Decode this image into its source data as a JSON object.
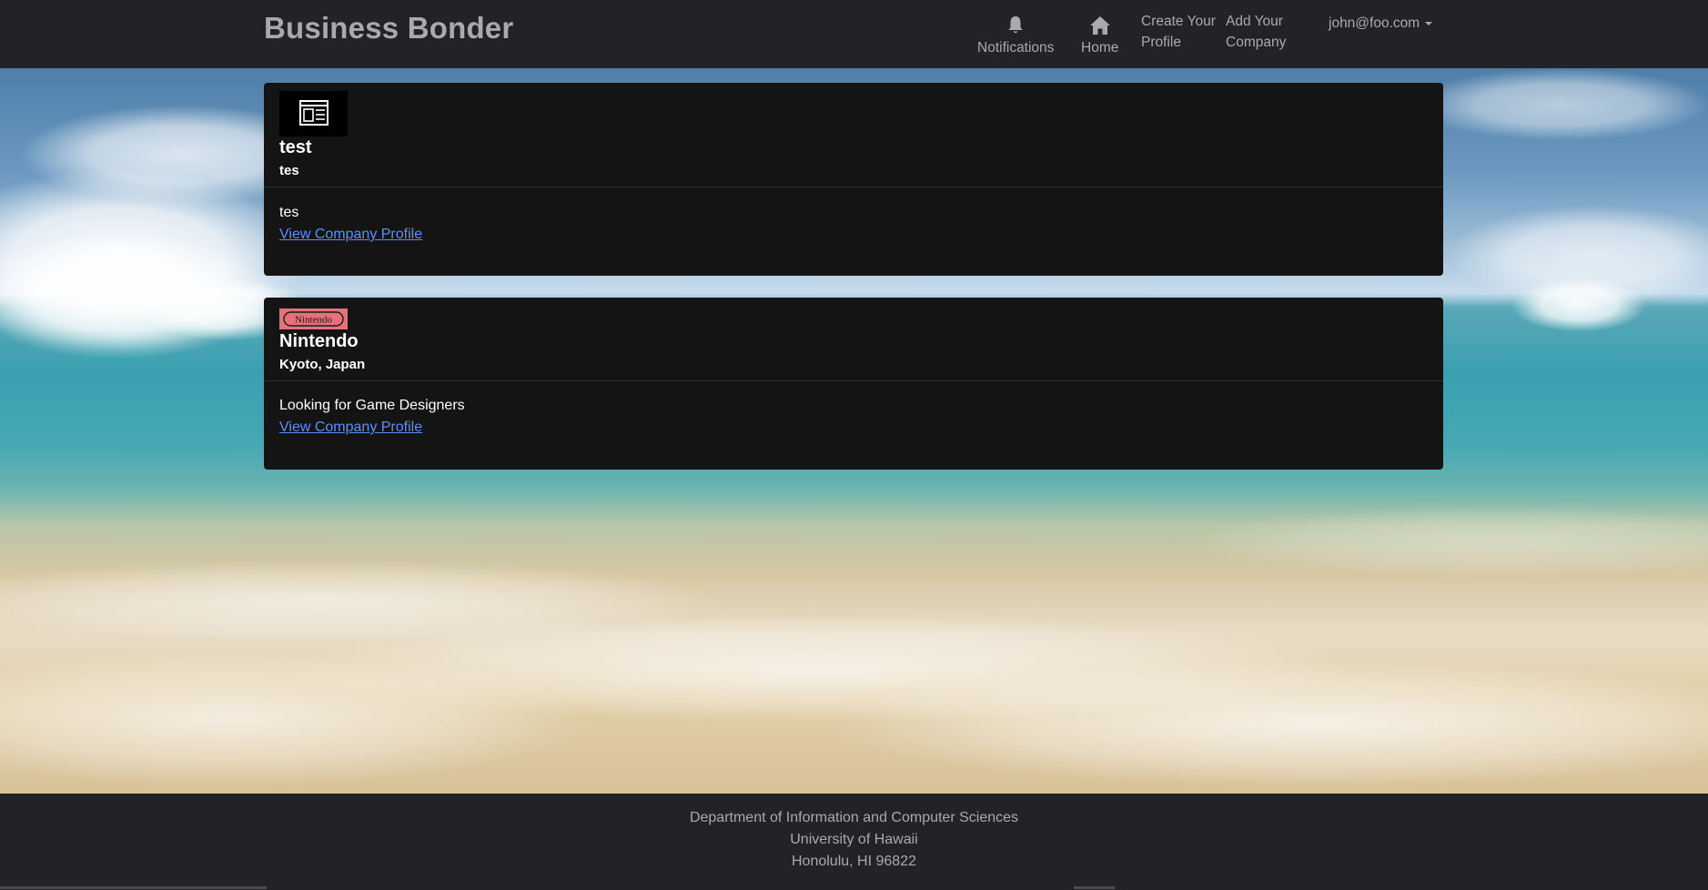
{
  "navbar": {
    "brand": "Business Bonder",
    "notifications_label": "Notifications",
    "home_label": "Home",
    "create_profile_label_line1": "Create Your",
    "create_profile_label_line2": "Profile",
    "add_company_label_line1": "Add Your",
    "add_company_label_line2": "Company",
    "user_email": "john@foo.com"
  },
  "cards": [
    {
      "logo_icon": "newspaper-icon",
      "name": "test",
      "location": "tes",
      "description": "tes",
      "link_label": "View Company Profile"
    },
    {
      "logo_text": "Nintendo",
      "logo_color": "#e8707a",
      "name": "Nintendo",
      "location": "Kyoto, Japan",
      "description": "Looking for Game Designers",
      "link_label": "View Company Profile"
    }
  ],
  "footer": {
    "line1": "Department of Information and Computer Sciences",
    "line2": "University of Hawaii",
    "line3": "Honolulu, HI 96822"
  },
  "colors": {
    "nav_bg": "#212326",
    "nav_text": "#a8aaad",
    "card_bg": "#141414",
    "link": "#5b8fff"
  }
}
